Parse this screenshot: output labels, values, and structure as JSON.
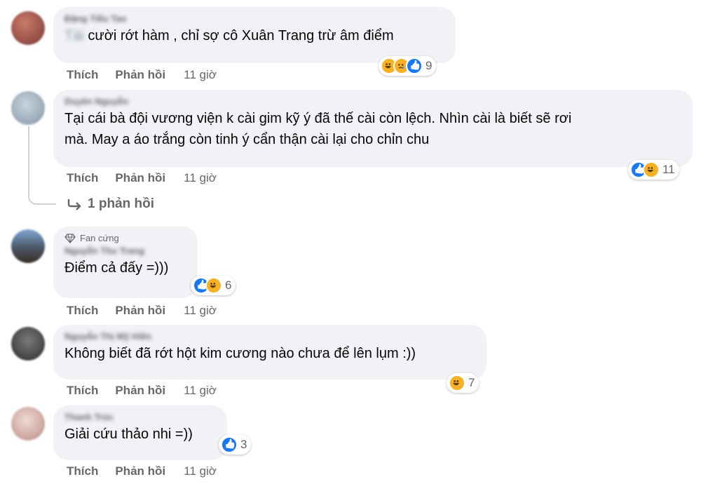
{
  "actions": {
    "like_label": "Thích",
    "reply_label": "Phản hồi"
  },
  "comments": [
    {
      "author": "Đặng Tiểu Tao",
      "tagged_name": "Tài",
      "text": "cười rớt hàm , chỉ sợ cô Xuân Trang trừ âm điểm",
      "time": "11 giờ",
      "reactions": [
        "haha",
        "sad",
        "like"
      ],
      "reaction_count": "9",
      "avatar_color": "#9a4a3e"
    },
    {
      "author": "Duyên Nguyễn",
      "text": "Tại cái bà đội vương viện k cài gim kỹ ý đã thế cài còn lệch. Nhìn cài là biết sẽ rơi\nmà. May a áo trắng còn tinh ý cẩn thận cài lại cho chỉn chu",
      "time": "11 giờ",
      "reactions": [
        "like",
        "haha"
      ],
      "reaction_count": "11",
      "avatar_color": "#a9b7c6",
      "replies_label": "1 phản hồi"
    },
    {
      "badge": "Fan cứng",
      "author": "Nguyễn Thu Trang",
      "text": "Điểm cả đấy =)))",
      "time": "11 giờ",
      "reactions": [
        "like",
        "haha"
      ],
      "reaction_count": "6",
      "avatar_color": "#5f6673"
    },
    {
      "author": "Nguyễn Thị Mỹ Hiền",
      "text": "Không biết đã rớt hột kim cương nào chưa để lên lụm :))",
      "time": "11 giờ",
      "reactions": [
        "haha"
      ],
      "reaction_count": "7",
      "avatar_color": "#4a4a4a"
    },
    {
      "author": "Thanh Trúc",
      "text": "Giải cứu thảo nhi =))",
      "time": "11 giờ",
      "reactions": [
        "like"
      ],
      "reaction_count": "3",
      "avatar_color": "#d7b5ad"
    }
  ]
}
